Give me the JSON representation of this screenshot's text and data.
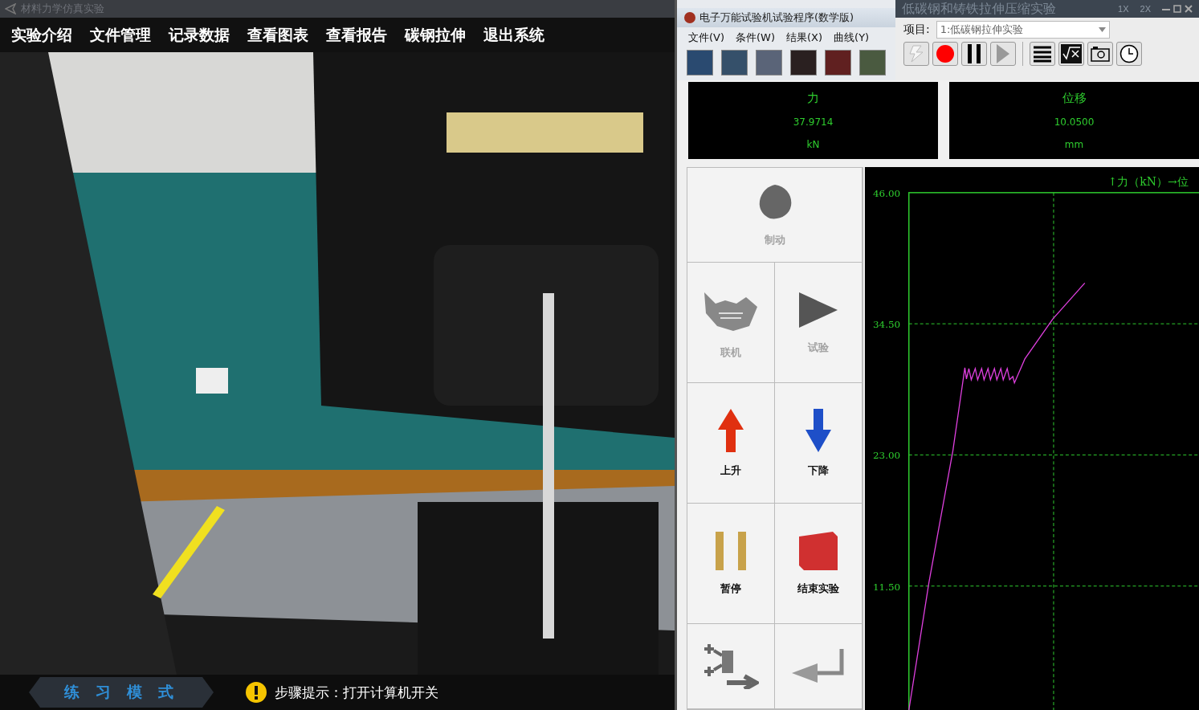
{
  "sim_window": {
    "title": "材料力学仿真实验",
    "menu": [
      "实验介绍",
      "文件管理",
      "记录数据",
      "查看图表",
      "查看报告",
      "碳钢拉伸",
      "退出系统"
    ],
    "mode": "练习模式",
    "hint": "步骤提示：打开计算机开关"
  },
  "program_window": {
    "title": "电子万能试验机试验程序(数学版)",
    "menu": [
      "文件(V)",
      "条件(W)",
      "结果(X)",
      "曲线(Y)"
    ]
  },
  "experiment_window": {
    "title": "低碳钢和铸铁拉伸压缩实验",
    "speed_buttons": [
      "1X",
      "2X"
    ],
    "project_label": "项目:",
    "project_value": "1:低碳钢拉伸实验"
  },
  "readouts": [
    {
      "label": "力",
      "value": "37.9714",
      "unit": "kN"
    },
    {
      "label": "位移",
      "value": "10.0500",
      "unit": "mm"
    }
  ],
  "controls": [
    {
      "kind": "brake",
      "label": "制动",
      "disabled": true
    },
    {
      "kind": "connect",
      "label": "联机",
      "disabled": true
    },
    {
      "kind": "test",
      "label": "试验",
      "disabled": true
    },
    {
      "kind": "up",
      "label": "上升",
      "disabled": false
    },
    {
      "kind": "down",
      "label": "下降",
      "disabled": false
    },
    {
      "kind": "pause",
      "label": "暂停",
      "disabled": false
    },
    {
      "kind": "stop",
      "label": "结束实验",
      "disabled": false
    },
    {
      "kind": "export"
    },
    {
      "kind": "return"
    }
  ],
  "chart": {
    "axis_title": "↑力（kN）→位",
    "y_labels": [
      "46.00",
      "34.50",
      "23.00",
      "11.50"
    ]
  }
}
